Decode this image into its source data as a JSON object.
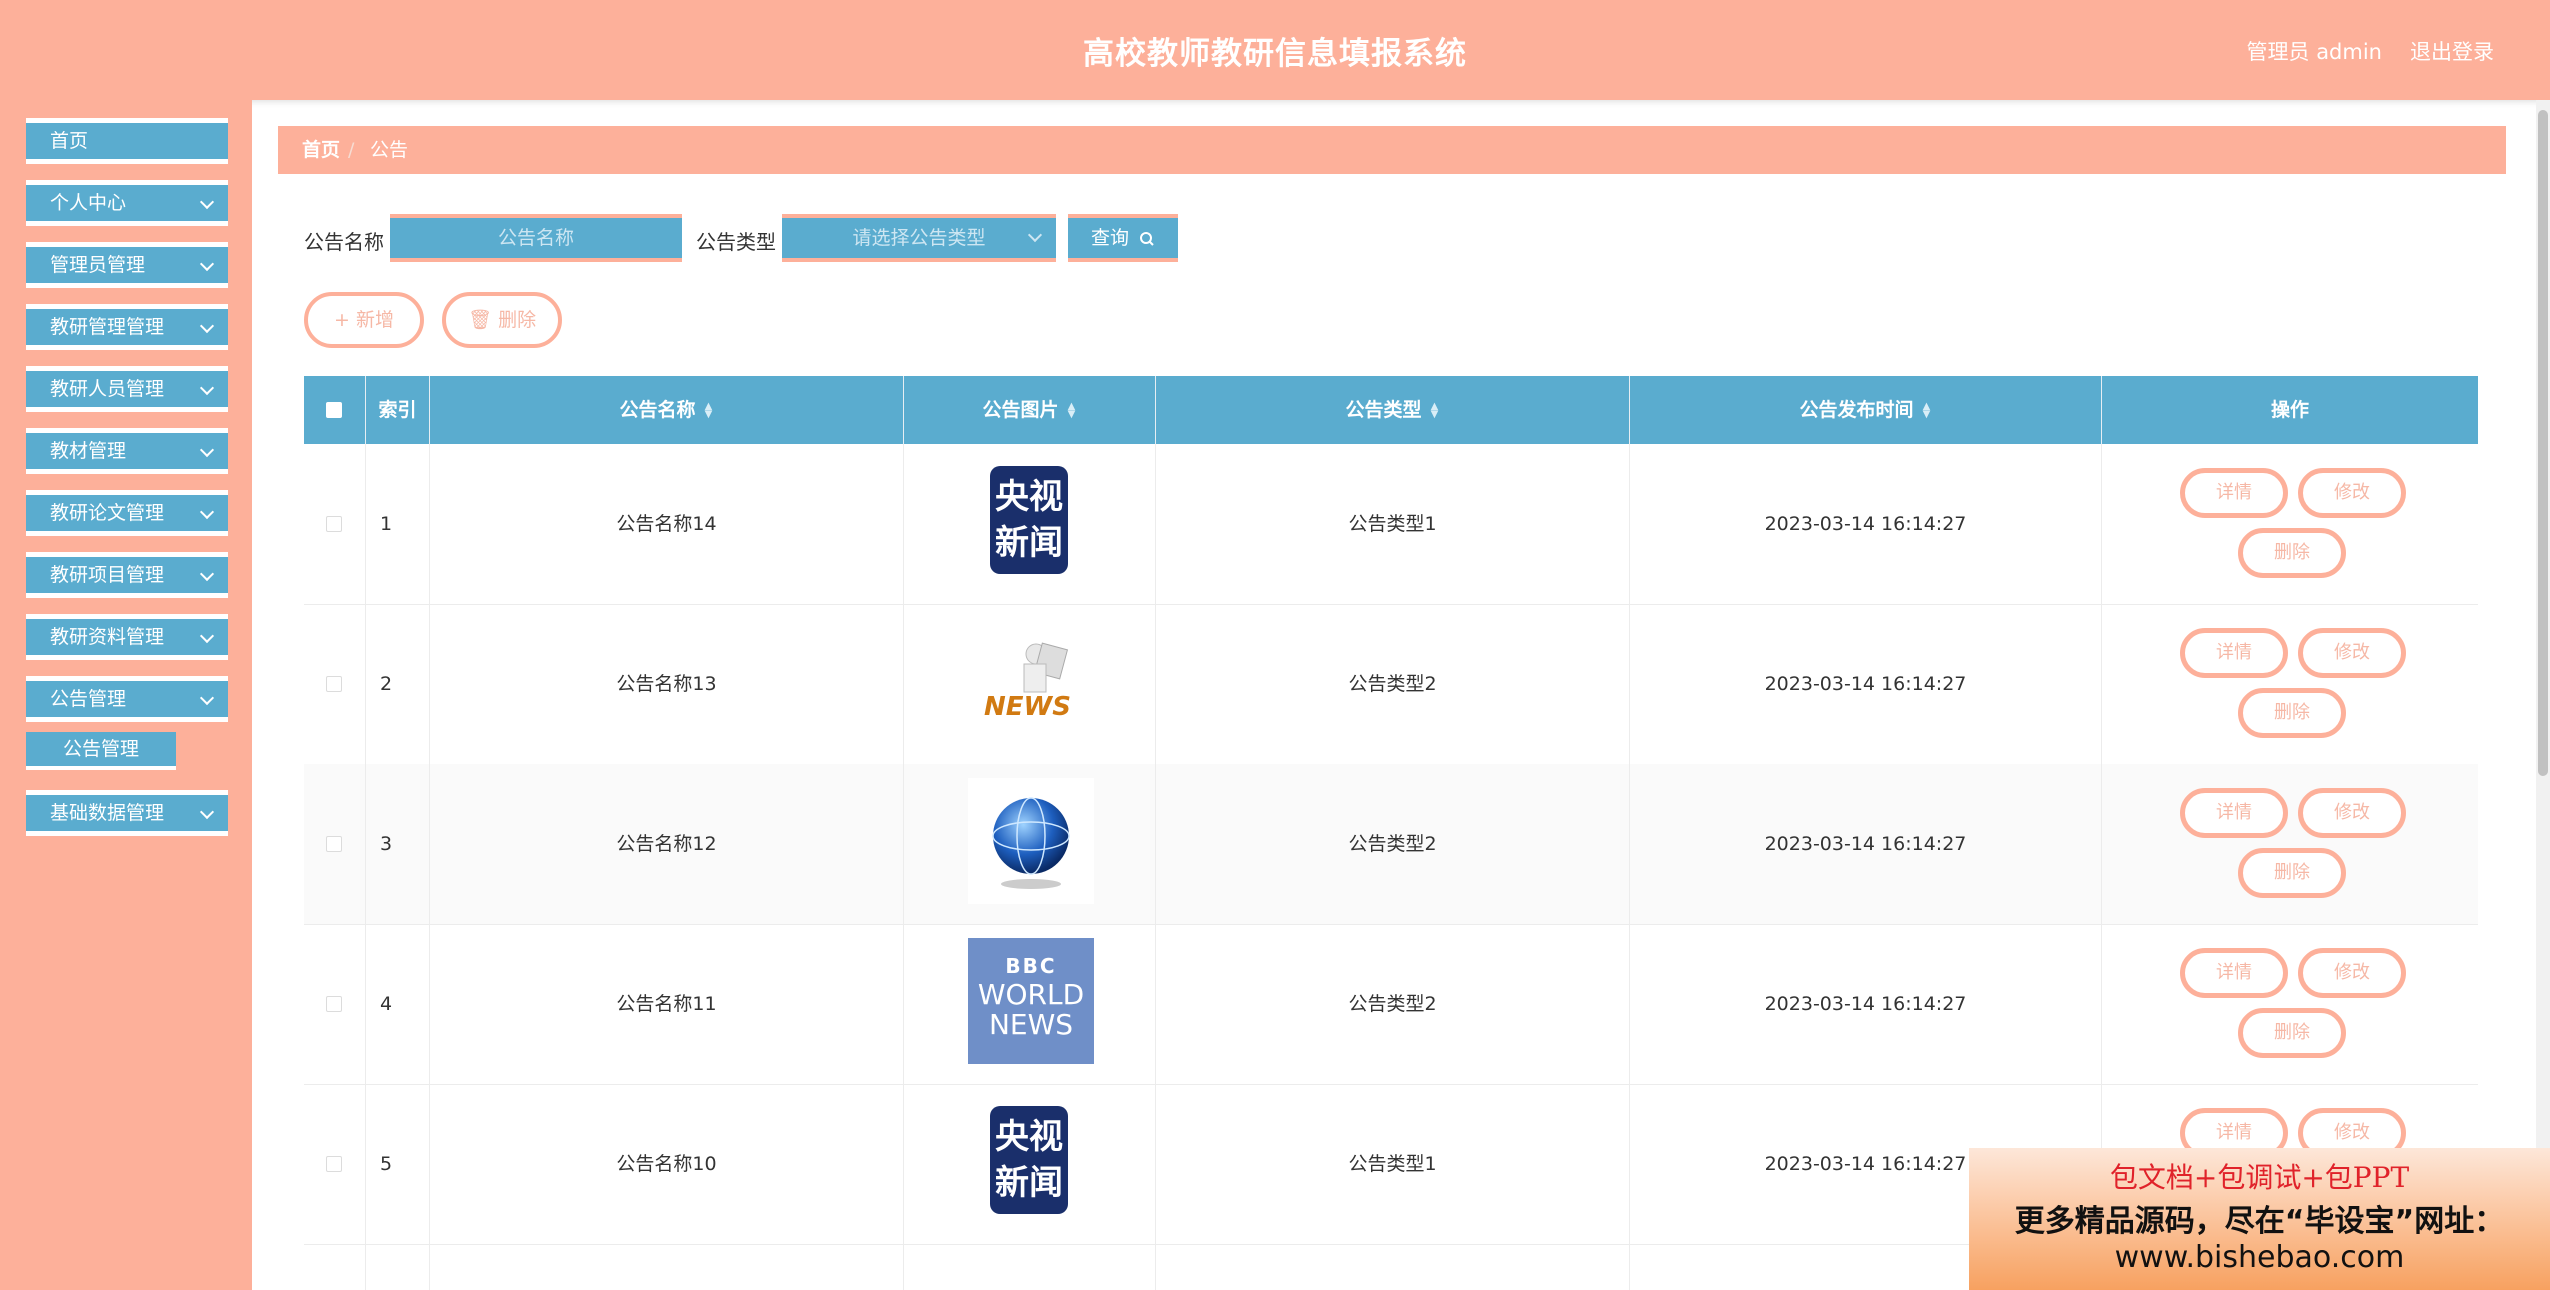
{
  "header": {
    "title": "高校教师教研信息填报系统",
    "user": "管理员 admin",
    "logout": "退出登录"
  },
  "sidebar": {
    "items": [
      {
        "label": "首页"
      },
      {
        "label": "个人中心"
      },
      {
        "label": "管理员管理"
      },
      {
        "label": "教研管理管理"
      },
      {
        "label": "教研人员管理"
      },
      {
        "label": "教材管理"
      },
      {
        "label": "教研论文管理"
      },
      {
        "label": "教研项目管理"
      },
      {
        "label": "教研资料管理"
      },
      {
        "label": "公告管理"
      },
      {
        "label": "基础数据管理"
      }
    ],
    "sub_item": "公告管理"
  },
  "breadcrumb": {
    "home": "首页",
    "separator": "/",
    "current": "公告"
  },
  "search": {
    "name_label": "公告名称",
    "name_placeholder": "公告名称",
    "type_label": "公告类型",
    "type_placeholder": "请选择公告类型",
    "query_button": "查询"
  },
  "toolbar": {
    "add": "+ 新增",
    "delete": "删除"
  },
  "table": {
    "headers": {
      "index": "索引",
      "name": "公告名称",
      "image": "公告图片",
      "type": "公告类型",
      "time": "公告发布时间",
      "ops": "操作"
    },
    "actions": {
      "detail": "详情",
      "edit": "修改",
      "delete": "删除"
    },
    "rows": [
      {
        "index": "1",
        "name": "公告名称14",
        "image": "cctv-news",
        "type": "公告类型1",
        "time": "2023-03-14 16:14:27"
      },
      {
        "index": "2",
        "name": "公告名称13",
        "image": "news-figure",
        "type": "公告类型2",
        "time": "2023-03-14 16:14:27"
      },
      {
        "index": "3",
        "name": "公告名称12",
        "image": "news-globe",
        "type": "公告类型2",
        "time": "2023-03-14 16:14:27"
      },
      {
        "index": "4",
        "name": "公告名称11",
        "image": "bbc-world-news",
        "type": "公告类型2",
        "time": "2023-03-14 16:14:27"
      },
      {
        "index": "5",
        "name": "公告名称10",
        "image": "cctv-news",
        "type": "公告类型1",
        "time": "2023-03-14 16:14:27"
      }
    ]
  },
  "logos": {
    "cctv_line1": "央视",
    "cctv_line2": "新闻",
    "news_word": "NEWS",
    "bbc_word": "BBC",
    "world": "WORLD",
    "news": "NEWS"
  },
  "ad": {
    "line1": "包文档+包调试+包PPT",
    "line2": "更多精品源码，尽在“毕设宝”网址：",
    "line3": "www.bishebao.com"
  },
  "colors": {
    "accent": "#fdb09a",
    "primary": "#5aaccf"
  }
}
